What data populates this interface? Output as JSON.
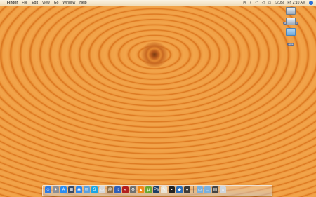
{
  "menubar": {
    "apple_glyph": "",
    "menus": [
      "Finder",
      "File",
      "Edit",
      "View",
      "Go",
      "Window",
      "Help"
    ],
    "battery_text": "(3:05)",
    "clock_text": "Fri 2:10 AM"
  },
  "desktop_icons": [
    {
      "label": "Macintosh HD",
      "kind": "drive"
    },
    {
      "label": "Volume",
      "kind": "drive"
    },
    {
      "label": "Apps",
      "kind": "folder"
    }
  ],
  "dock": {
    "apps": [
      {
        "name": "finder-icon",
        "glyph": "☺",
        "color": "#2f7be0"
      },
      {
        "name": "launchpad-icon",
        "glyph": "✦",
        "color": "#8a8f99"
      },
      {
        "name": "app-store-icon",
        "glyph": "A",
        "color": "#2a8df2"
      },
      {
        "name": "mission-control-icon",
        "glyph": "▦",
        "color": "#3a4a66"
      },
      {
        "name": "safari-icon",
        "glyph": "◉",
        "color": "#2f86e8"
      },
      {
        "name": "mail-icon",
        "glyph": "✉",
        "color": "#5aa0dd"
      },
      {
        "name": "skype-icon",
        "glyph": "S",
        "color": "#19a6e6"
      },
      {
        "name": "calendar-icon",
        "glyph": "▭",
        "color": "#d8d8d8"
      },
      {
        "name": "address-book-icon",
        "glyph": "@",
        "color": "#8b6b44"
      },
      {
        "name": "itunes-icon",
        "glyph": "♫",
        "color": "#2f5fb8"
      },
      {
        "name": "photo-booth-icon",
        "glyph": "◐",
        "color": "#b21e1e"
      },
      {
        "name": "system-preferences-icon",
        "glyph": "⚙",
        "color": "#707070"
      },
      {
        "name": "vlc-icon",
        "glyph": "▲",
        "color": "#f08a18"
      },
      {
        "name": "utorrent-icon",
        "glyph": "µ",
        "color": "#6aa832"
      },
      {
        "name": "photoshop-icon",
        "glyph": "Ps",
        "color": "#1c3f66"
      },
      {
        "name": "textedit-icon",
        "glyph": "✎",
        "color": "#e9e4d6"
      },
      {
        "name": "terminal-icon",
        "glyph": "▪",
        "color": "#222222"
      },
      {
        "name": "game-icon",
        "glyph": "◆",
        "color": "#2d6fb8"
      },
      {
        "name": "app-icon",
        "glyph": "●",
        "color": "#3a3a3a"
      }
    ],
    "docs": [
      {
        "name": "applications-folder-icon",
        "glyph": "▭",
        "color": "#7ab0dd"
      },
      {
        "name": "documents-folder-icon",
        "glyph": "▭",
        "color": "#7ab0dd"
      },
      {
        "name": "downloads-stack-icon",
        "glyph": "▤",
        "color": "#444444"
      },
      {
        "name": "trash-icon",
        "glyph": "⌂",
        "color": "#cfd6dd"
      }
    ]
  }
}
